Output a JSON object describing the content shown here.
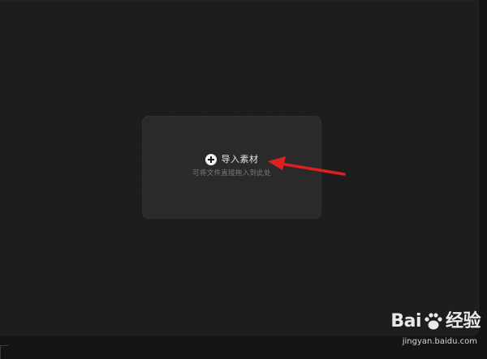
{
  "drop_zone": {
    "import_label": "导入素材",
    "hint": "可将文件直接拖入到此处"
  },
  "annotation": {
    "arrow_color": "#e02020"
  },
  "watermark": {
    "logo_left": "Bai",
    "logo_right": "经验",
    "url": "jingyan.baidu.com"
  },
  "colors": {
    "panel_bg": "#1d1d1d",
    "drop_zone_bg": "#2a2a2a",
    "hint_text": "#7a7a7a"
  }
}
